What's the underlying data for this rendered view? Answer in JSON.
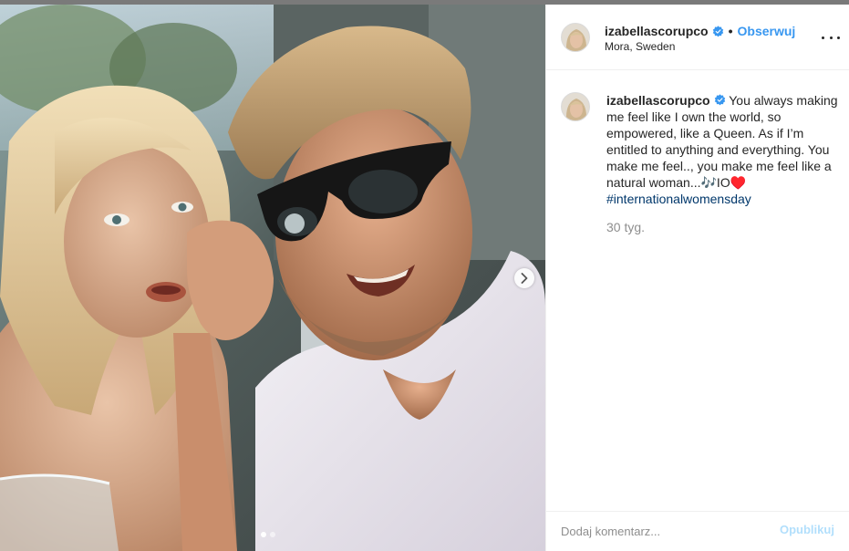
{
  "header": {
    "username": "izabellascorupco",
    "separator": "•",
    "follow_label": "Obserwuj",
    "location": "Mora, Sweden",
    "more_icon": "more-horizontal-icon",
    "verified_icon": "verified-badge-icon"
  },
  "caption": {
    "username": "izabellascorupco",
    "text": " You always making me feel like I own the world, so empowered, like a Queen. As if I’m entitled to anything and everything. You make me feel.., you make me feel like a natural woman...🎶IO♥️ ",
    "hashtag": "#internationalwomensday",
    "time": "30 tyg."
  },
  "carousel": {
    "next_icon": "chevron-right-icon",
    "slides": 2,
    "active_slide": 1
  },
  "comment": {
    "placeholder": "Dodaj komentarz...",
    "post_label": "Opublikuj"
  },
  "colors": {
    "link": "#3897f0",
    "post_disabled": "#b2dffc",
    "hashtag": "#00376b",
    "muted": "#8e8e8e"
  }
}
